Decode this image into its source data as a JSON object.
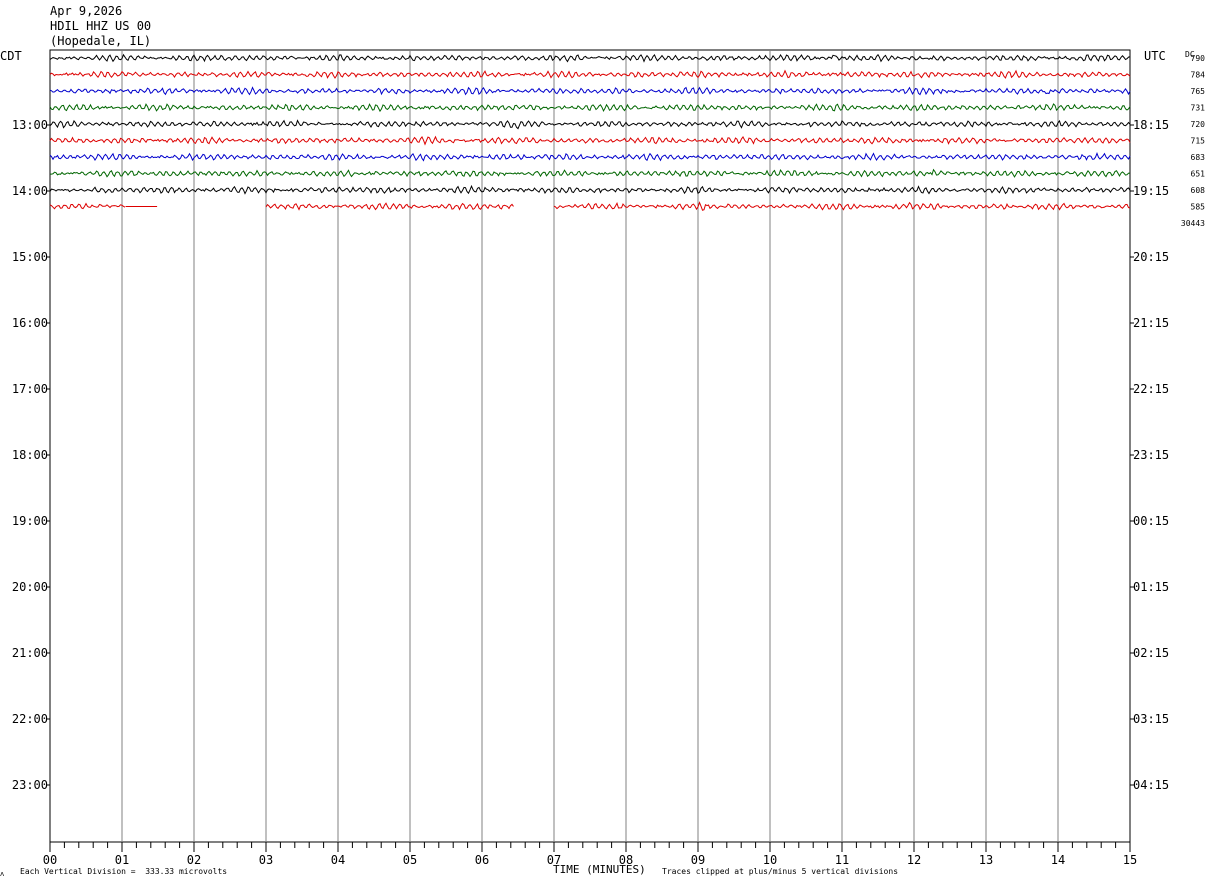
{
  "header": {
    "date": "Apr 9,2026",
    "station": "HDIL HHZ US 00",
    "location": "(Hopedale, IL)"
  },
  "left_axis_title": "CDT",
  "right_axis_title": "UTC",
  "dc_label": "DC",
  "footer": {
    "scale_note": "Each Vertical Division =  333.33 microvolts",
    "xlabel": "TIME (MINUTES)",
    "clip_note": "Traces clipped at plus/minus 5 vertical divisions",
    "corner_mark": "ᴧ"
  },
  "colors": {
    "black": "#000000",
    "red": "#dd0000",
    "blue": "#0000cc",
    "green": "#006600",
    "grid": "#808080"
  },
  "chart_data": {
    "type": "line",
    "title": "HDIL HHZ US 00 (Hopedale, IL)",
    "xlabel": "TIME (MINUTES)",
    "xlim": [
      0,
      15
    ],
    "x_ticks": [
      "00",
      "01",
      "02",
      "03",
      "04",
      "05",
      "06",
      "07",
      "08",
      "09",
      "10",
      "11",
      "12",
      "13",
      "14",
      "15"
    ],
    "left_time_labels": [
      "13:00",
      "14:00",
      "15:00",
      "16:00",
      "17:00",
      "18:00",
      "19:00",
      "20:00",
      "21:00",
      "22:00",
      "23:00"
    ],
    "right_time_labels": [
      "18:15",
      "19:15",
      "20:15",
      "21:15",
      "22:15",
      "23:15",
      "00:15",
      "01:15",
      "02:15",
      "03:15",
      "04:15"
    ],
    "trace_colors": [
      "black",
      "red",
      "blue",
      "green"
    ],
    "dc_offsets": [
      "790",
      "784",
      "765",
      "731",
      "720",
      "715",
      "683",
      "651",
      "608",
      "585",
      "30443"
    ],
    "traces": [
      {
        "row": 0,
        "color": "black",
        "segments": [
          [
            0,
            15
          ]
        ],
        "events": [
          10.9
        ]
      },
      {
        "row": 1,
        "color": "red",
        "segments": [
          [
            0,
            15
          ]
        ],
        "events": []
      },
      {
        "row": 2,
        "color": "blue",
        "segments": [
          [
            0,
            15
          ]
        ],
        "events": [
          13.85
        ]
      },
      {
        "row": 3,
        "color": "green",
        "segments": [
          [
            0,
            15
          ]
        ],
        "events": []
      },
      {
        "row": 4,
        "color": "black",
        "segments": [
          [
            0,
            15
          ]
        ],
        "events": [
          6.45
        ]
      },
      {
        "row": 5,
        "color": "red",
        "segments": [
          [
            0,
            15
          ]
        ],
        "events": []
      },
      {
        "row": 6,
        "color": "blue",
        "segments": [
          [
            0,
            15
          ]
        ],
        "events": []
      },
      {
        "row": 7,
        "color": "green",
        "segments": [
          [
            0,
            15
          ]
        ],
        "events": [
          12.25
        ]
      },
      {
        "row": 8,
        "color": "black",
        "segments": [
          [
            0,
            15
          ]
        ],
        "events": []
      },
      {
        "row": 9,
        "color": "red",
        "segments": [
          [
            0,
            1.05
          ],
          [
            1.05,
            1.5
          ],
          [
            3.0,
            6.45
          ],
          [
            7.0,
            15
          ]
        ],
        "flat": [
          1
        ],
        "events": [
          9.05,
          11.9
        ]
      }
    ]
  }
}
